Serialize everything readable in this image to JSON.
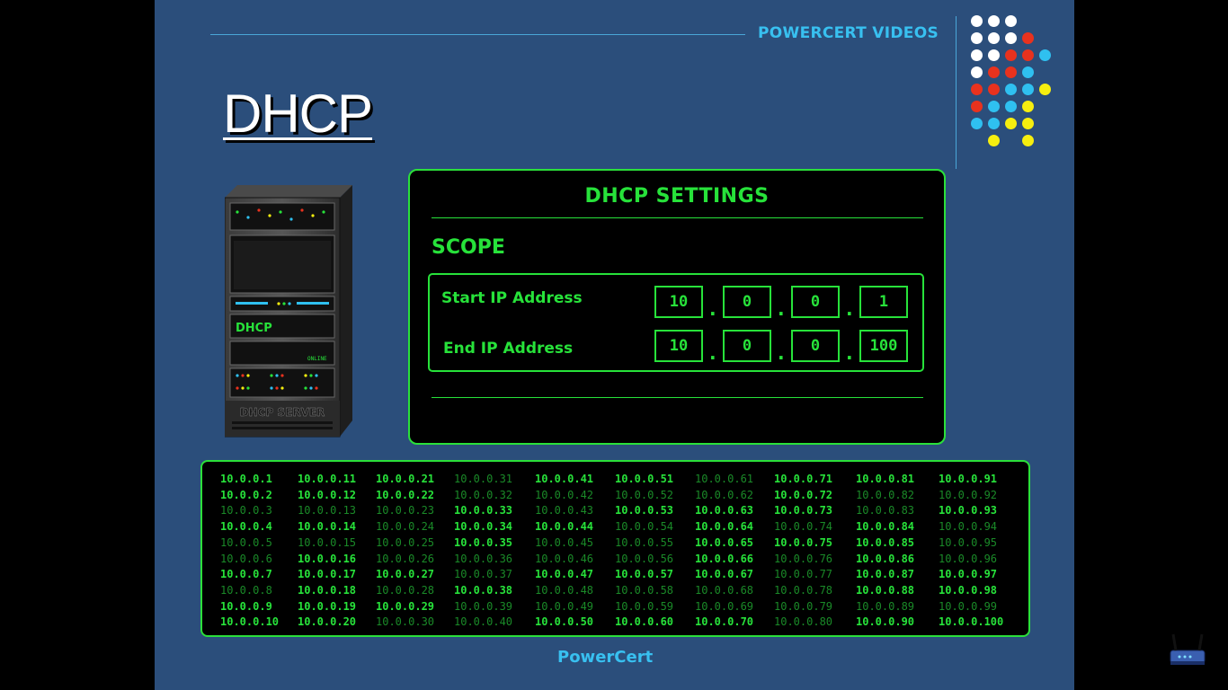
{
  "brand": {
    "channel": "POWERCERT VIDEOS",
    "footer": "PowerCert"
  },
  "page": {
    "title": "DHCP"
  },
  "server": {
    "label": "DHCP SERVER",
    "display": "DHCP",
    "status": "ONLINE"
  },
  "settings": {
    "title": "DHCP SETTINGS",
    "scope_label": "SCOPE",
    "start_label": "Start IP Address",
    "end_label": "End IP Address",
    "start_ip": [
      "10",
      "0",
      "0",
      "1"
    ],
    "end_ip": [
      "10",
      "0",
      "0",
      "100"
    ]
  },
  "pool": {
    "columns": [
      [
        {
          "ip": "10.0.0.1",
          "active": true
        },
        {
          "ip": "10.0.0.2",
          "active": true
        },
        {
          "ip": "10.0.0.3",
          "active": false
        },
        {
          "ip": "10.0.0.4",
          "active": true
        },
        {
          "ip": "10.0.0.5",
          "active": false
        },
        {
          "ip": "10.0.0.6",
          "active": false
        },
        {
          "ip": "10.0.0.7",
          "active": true
        },
        {
          "ip": "10.0.0.8",
          "active": false
        },
        {
          "ip": "10.0.0.9",
          "active": true
        },
        {
          "ip": "10.0.0.10",
          "active": true
        }
      ],
      [
        {
          "ip": "10.0.0.11",
          "active": true
        },
        {
          "ip": "10.0.0.12",
          "active": true
        },
        {
          "ip": "10.0.0.13",
          "active": false
        },
        {
          "ip": "10.0.0.14",
          "active": true
        },
        {
          "ip": "10.0.0.15",
          "active": false
        },
        {
          "ip": "10.0.0.16",
          "active": true
        },
        {
          "ip": "10.0.0.17",
          "active": true
        },
        {
          "ip": "10.0.0.18",
          "active": true
        },
        {
          "ip": "10.0.0.19",
          "active": true
        },
        {
          "ip": "10.0.0.20",
          "active": true
        }
      ],
      [
        {
          "ip": "10.0.0.21",
          "active": true
        },
        {
          "ip": "10.0.0.22",
          "active": true
        },
        {
          "ip": "10.0.0.23",
          "active": false
        },
        {
          "ip": "10.0.0.24",
          "active": false
        },
        {
          "ip": "10.0.0.25",
          "active": false
        },
        {
          "ip": "10.0.0.26",
          "active": false
        },
        {
          "ip": "10.0.0.27",
          "active": true
        },
        {
          "ip": "10.0.0.28",
          "active": false
        },
        {
          "ip": "10.0.0.29",
          "active": true
        },
        {
          "ip": "10.0.0.30",
          "active": false
        }
      ],
      [
        {
          "ip": "10.0.0.31",
          "active": false
        },
        {
          "ip": "10.0.0.32",
          "active": false
        },
        {
          "ip": "10.0.0.33",
          "active": true
        },
        {
          "ip": "10.0.0.34",
          "active": true
        },
        {
          "ip": "10.0.0.35",
          "active": true
        },
        {
          "ip": "10.0.0.36",
          "active": false
        },
        {
          "ip": "10.0.0.37",
          "active": false
        },
        {
          "ip": "10.0.0.38",
          "active": true
        },
        {
          "ip": "10.0.0.39",
          "active": false
        },
        {
          "ip": "10.0.0.40",
          "active": false
        }
      ],
      [
        {
          "ip": "10.0.0.41",
          "active": true
        },
        {
          "ip": "10.0.0.42",
          "active": false
        },
        {
          "ip": "10.0.0.43",
          "active": false
        },
        {
          "ip": "10.0.0.44",
          "active": true
        },
        {
          "ip": "10.0.0.45",
          "active": false
        },
        {
          "ip": "10.0.0.46",
          "active": false
        },
        {
          "ip": "10.0.0.47",
          "active": true
        },
        {
          "ip": "10.0.0.48",
          "active": false
        },
        {
          "ip": "10.0.0.49",
          "active": false
        },
        {
          "ip": "10.0.0.50",
          "active": true
        }
      ],
      [
        {
          "ip": "10.0.0.51",
          "active": true
        },
        {
          "ip": "10.0.0.52",
          "active": false
        },
        {
          "ip": "10.0.0.53",
          "active": true
        },
        {
          "ip": "10.0.0.54",
          "active": false
        },
        {
          "ip": "10.0.0.55",
          "active": false
        },
        {
          "ip": "10.0.0.56",
          "active": false
        },
        {
          "ip": "10.0.0.57",
          "active": true
        },
        {
          "ip": "10.0.0.58",
          "active": false
        },
        {
          "ip": "10.0.0.59",
          "active": false
        },
        {
          "ip": "10.0.0.60",
          "active": true
        }
      ],
      [
        {
          "ip": "10.0.0.61",
          "active": false
        },
        {
          "ip": "10.0.0.62",
          "active": false
        },
        {
          "ip": "10.0.0.63",
          "active": true
        },
        {
          "ip": "10.0.0.64",
          "active": true
        },
        {
          "ip": "10.0.0.65",
          "active": true
        },
        {
          "ip": "10.0.0.66",
          "active": true
        },
        {
          "ip": "10.0.0.67",
          "active": true
        },
        {
          "ip": "10.0.0.68",
          "active": false
        },
        {
          "ip": "10.0.0.69",
          "active": false
        },
        {
          "ip": "10.0.0.70",
          "active": true
        }
      ],
      [
        {
          "ip": "10.0.0.71",
          "active": true
        },
        {
          "ip": "10.0.0.72",
          "active": true
        },
        {
          "ip": "10.0.0.73",
          "active": true
        },
        {
          "ip": "10.0.0.74",
          "active": false
        },
        {
          "ip": "10.0.0.75",
          "active": true
        },
        {
          "ip": "10.0.0.76",
          "active": false
        },
        {
          "ip": "10.0.0.77",
          "active": false
        },
        {
          "ip": "10.0.0.78",
          "active": false
        },
        {
          "ip": "10.0.0.79",
          "active": false
        },
        {
          "ip": "10.0.0.80",
          "active": false
        }
      ],
      [
        {
          "ip": "10.0.0.81",
          "active": true
        },
        {
          "ip": "10.0.0.82",
          "active": false
        },
        {
          "ip": "10.0.0.83",
          "active": false
        },
        {
          "ip": "10.0.0.84",
          "active": true
        },
        {
          "ip": "10.0.0.85",
          "active": true
        },
        {
          "ip": "10.0.0.86",
          "active": true
        },
        {
          "ip": "10.0.0.87",
          "active": true
        },
        {
          "ip": "10.0.0.88",
          "active": true
        },
        {
          "ip": "10.0.0.89",
          "active": false
        },
        {
          "ip": "10.0.0.90",
          "active": true
        }
      ],
      [
        {
          "ip": "10.0.0.91",
          "active": true
        },
        {
          "ip": "10.0.0.92",
          "active": false
        },
        {
          "ip": "10.0.0.93",
          "active": true
        },
        {
          "ip": "10.0.0.94",
          "active": false
        },
        {
          "ip": "10.0.0.95",
          "active": false
        },
        {
          "ip": "10.0.0.96",
          "active": false
        },
        {
          "ip": "10.0.0.97",
          "active": true
        },
        {
          "ip": "10.0.0.98",
          "active": true
        },
        {
          "ip": "10.0.0.99",
          "active": false
        },
        {
          "ip": "10.0.0.100",
          "active": true
        }
      ]
    ]
  },
  "colors": {
    "slide_bg": "#2b4e7b",
    "accent_green": "#27e23a",
    "accent_blue": "#38c0f0",
    "dot_white": "#ffffff",
    "dot_red": "#e8321e",
    "dot_blue": "#2fc0f0",
    "dot_yellow": "#f6ee0f"
  },
  "icons": {
    "logo_dots": "dot-grid-logo",
    "router": "router-icon",
    "server": "server-rack-icon"
  }
}
